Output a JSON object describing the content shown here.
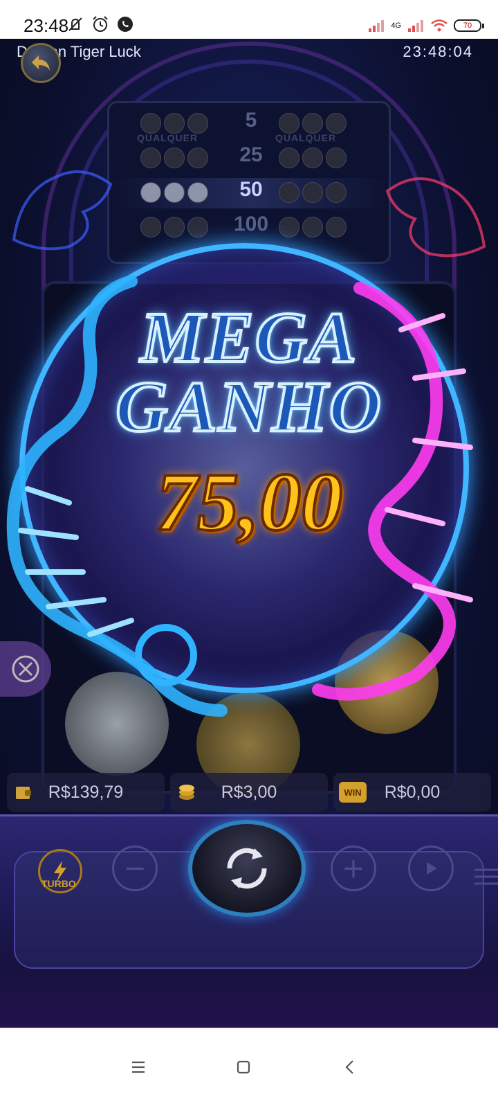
{
  "status_bar": {
    "time": "23:48",
    "network": "4G",
    "battery": "70",
    "icons": [
      "mute-icon",
      "alarm-icon",
      "whatsapp-icon",
      "signal-icon",
      "wifi-icon",
      "battery-icon"
    ]
  },
  "game": {
    "title": "Dragon Tiger Luck",
    "clock": "23:48:04",
    "paytable": {
      "any_label": "QUALQUER",
      "rows": [
        {
          "value": "5",
          "active": false
        },
        {
          "value": "25",
          "active": false
        },
        {
          "value": "50",
          "active": true
        },
        {
          "value": "100",
          "active": false
        }
      ]
    },
    "win": {
      "line1": "MEGA",
      "line2": "GANHO",
      "amount": "75,00"
    },
    "hud": {
      "balance": "R$139,79",
      "bet": "R$3,00",
      "win_badge": "WIN",
      "win": "R$0,00"
    },
    "controls": {
      "turbo_label": "TURBO",
      "minus": "−",
      "plus": "+"
    }
  },
  "colors": {
    "mega_text": "#1b58b8",
    "amount_text": "#ffc21a",
    "tiger_glow": "#2fb3ff",
    "dragon_glow": "#ff3cf0"
  }
}
